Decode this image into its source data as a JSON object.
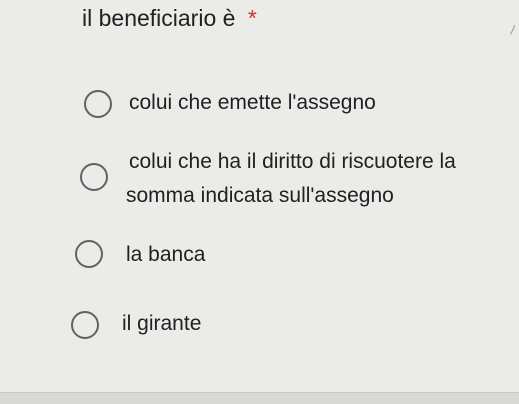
{
  "question": {
    "title": "il beneficiario è",
    "required_marker": "*"
  },
  "options": [
    {
      "label": "colui che emette l'assegno"
    },
    {
      "label_line1": "colui che ha il diritto di riscuotere la",
      "label_line2": "somma indicata sull'assegno"
    },
    {
      "label": "la banca"
    },
    {
      "label": "il girante"
    }
  ],
  "colors": {
    "background": "#ebebe8",
    "required": "#d93025",
    "radio_border": "#5f6368",
    "text": "#202124"
  }
}
